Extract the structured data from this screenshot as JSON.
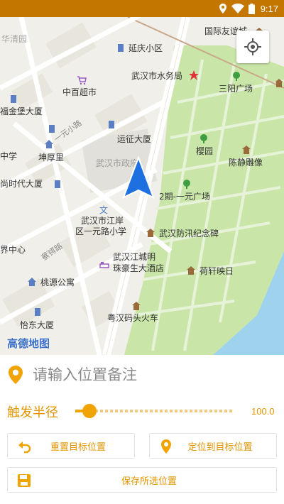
{
  "status_bar": {
    "time": "9:17"
  },
  "map": {
    "labels": {
      "guoji": "国际友谊城",
      "huaqing": "华清园",
      "yanqing": "延庆小区",
      "shuiwu": "武汉市水务局",
      "sanyang": "三阳广场",
      "zhongbai": "中百超市",
      "fujinbao": "福金堡大厦",
      "yiyuan_road": "一元小路",
      "yunzheng": "运征大厦",
      "zhongxue": "中学",
      "kunhou": "坤厚里",
      "gov": "武汉市政府",
      "yingyuan": "樱园",
      "chenjing": "陈静雕像",
      "shidai": "尚时代大厦",
      "erqi": "2期-一元广场",
      "xiaoxue_1": "武汉市江岸",
      "xiaoxue_2": "区一元路小学",
      "fangxun": "武汉防汛纪念碑",
      "zhongxin": "界中心",
      "caie_road": "蔡锷路",
      "jiangcheng_1": "武汉江城明",
      "jiangcheng_2": "珠豪生大酒店",
      "hexuan": "荷轩映日",
      "taoyuan": "桃源公寓",
      "yuehan": "粤汉码头火车",
      "yidong": "怡东大厦",
      "logo": "高德地图"
    }
  },
  "panel": {
    "note_placeholder": "请输入位置备注",
    "radius_label": "触发半径",
    "radius_value": "100.0",
    "radius_fraction": 0.09,
    "reset_button": "重置目标位置",
    "locate_button": "定位到目标位置",
    "save_button": "保存所选位置"
  },
  "colors": {
    "accent": "#f1a300",
    "status_bar": "#c37600",
    "park": "#c9e6a8",
    "water": "#9fd2ec"
  },
  "icons": {
    "note": "location-pin-icon",
    "reset": "undo-icon",
    "locate": "location-pin-icon",
    "save": "save-icon",
    "locate_me": "crosshair-icon"
  }
}
